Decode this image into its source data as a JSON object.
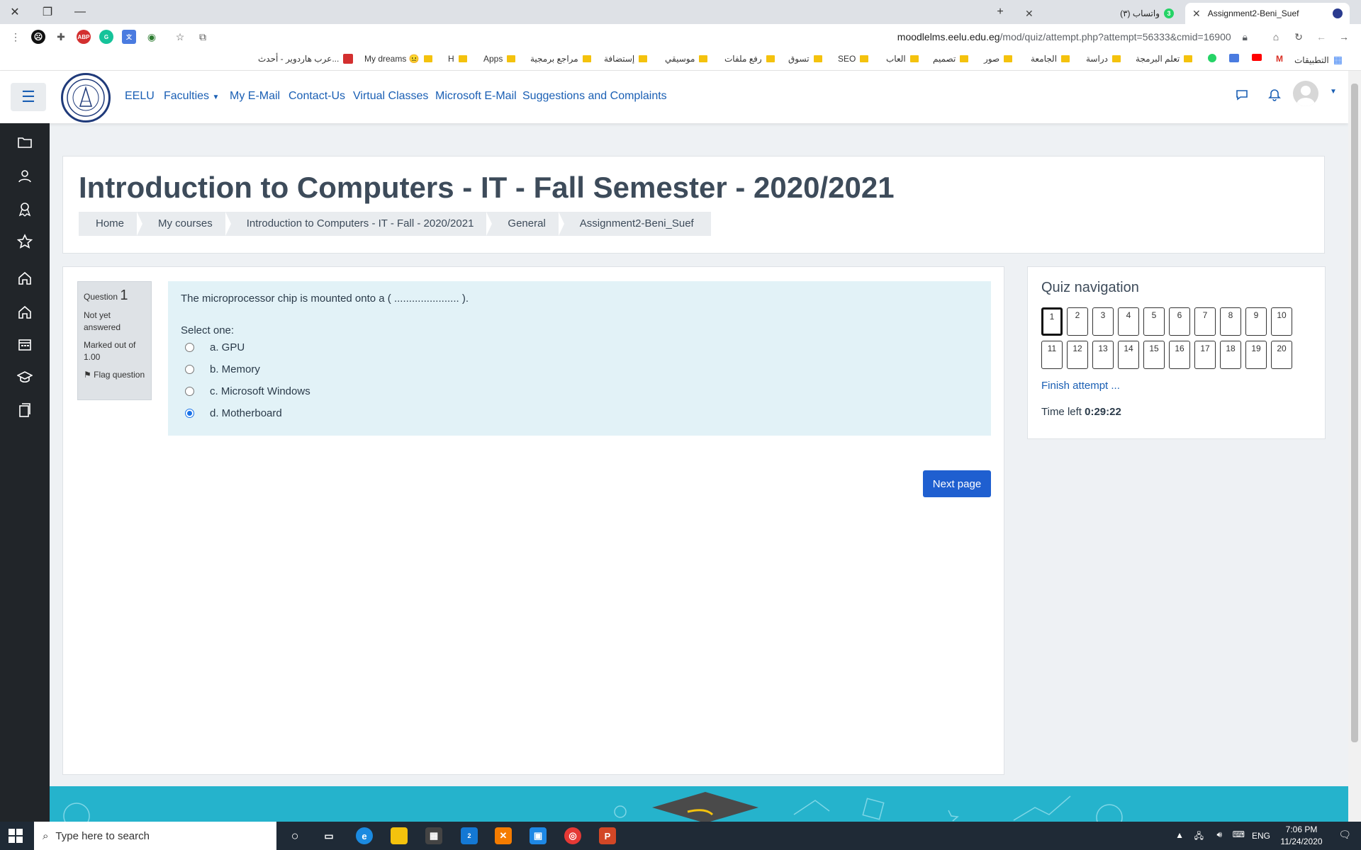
{
  "browser": {
    "tabs": [
      {
        "title": "(٣) واتساب",
        "badge": "3"
      },
      {
        "title": "Assignment2-Beni_Suef"
      }
    ],
    "url_host": "moodlelms.eelu.edu.eg",
    "url_path": "/mod/quiz/attempt.php?attempt=56333&cmid=16900",
    "bookmarks": [
      "التطبيقات",
      "تعلم البرمجة",
      "دراسة",
      "الجامعة",
      "صور",
      "تصميم",
      "العاب",
      "SEO",
      "تسوق",
      "رفع ملفات",
      "موسيقي",
      "إستضافة",
      "مراجع برمجية",
      "Apps",
      "H",
      "My dreams 😐",
      "عرب هاردوير - أحدث..."
    ]
  },
  "navbar": {
    "links": [
      "EELU",
      "Faculties",
      "My E-Mail",
      "Contact-Us",
      "Virtual Classes",
      "Microsoft E-Mail",
      "Suggestions and Complaints"
    ]
  },
  "header": {
    "title": "Introduction to Computers - IT - Fall Semester - 2020/2021",
    "breadcrumb": [
      "Home",
      "My courses",
      "Introduction to Computers - IT - Fall - 2020/2021",
      "General",
      "Assignment2-Beni_Suef"
    ]
  },
  "question": {
    "label": "Question",
    "number": "1",
    "status": "Not yet answered",
    "marked": "Marked out of 1.00",
    "flag": "Flag question",
    "text": "The microprocessor chip is mounted onto a ( ...................... ).",
    "select_label": "Select one:",
    "options": [
      {
        "label": "a. GPU",
        "checked": false
      },
      {
        "label": "b. Memory",
        "checked": false
      },
      {
        "label": "c. Microsoft Windows",
        "checked": false
      },
      {
        "label": "d. Motherboard",
        "checked": true
      }
    ],
    "next_label": "Next page"
  },
  "quiz_nav": {
    "title": "Quiz navigation",
    "questions": [
      "1",
      "2",
      "3",
      "4",
      "5",
      "6",
      "7",
      "8",
      "9",
      "10",
      "11",
      "12",
      "13",
      "14",
      "15",
      "16",
      "17",
      "18",
      "19",
      "20"
    ],
    "current": "1",
    "finish_label": "Finish attempt ...",
    "time_label": "Time left",
    "time_value": "0:29:22"
  },
  "taskbar": {
    "search_placeholder": "Type here to search",
    "lang": "ENG",
    "time": "7:06 PM",
    "date": "11/24/2020",
    "mail_badge": "2"
  },
  "colors": {
    "link": "#1a5fb4",
    "primary_button": "#1f5fd0",
    "question_bg": "#e2f2f7",
    "drawer": "#212529",
    "footer": "#25b3cc"
  }
}
